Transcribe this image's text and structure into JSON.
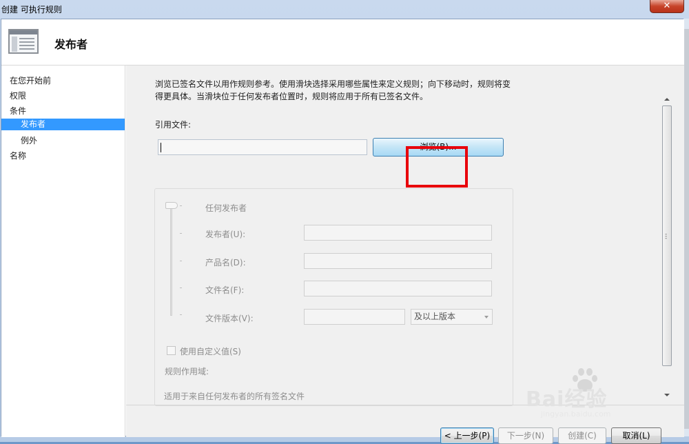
{
  "window": {
    "title": "创建 可执行规则",
    "close_glyph": "✕"
  },
  "header": {
    "title": "发布者",
    "icon": "wizard-icon"
  },
  "nav": {
    "items": [
      {
        "label": "在您开始前"
      },
      {
        "label": "权限"
      },
      {
        "label": "条件"
      },
      {
        "label": "发布者",
        "selected": true
      },
      {
        "label": "例外"
      },
      {
        "label": "名称"
      }
    ]
  },
  "main": {
    "description": "浏览已签名文件以用作规则参考。使用滑块选择采用哪些属性来定义规则；向下移动时，规则将变得更具体。当滑块位于任何发布者位置时，规则将应用于所有已签名文件。",
    "reference_label": "引用文件:",
    "reference_value": "",
    "browse_label": "浏览(B)...",
    "panel": {
      "any_publisher": "任何发布者",
      "publisher_label": "发布者(U):",
      "publisher_value": "",
      "product_label": "产品名(D):",
      "product_value": "",
      "filename_label": "文件名(F):",
      "filename_value": "",
      "version_label": "文件版本(V):",
      "version_value": "",
      "version_mode": "及以上版本",
      "custom_values_label": "使用自定义值(S)",
      "scope_label": "规则作用域:",
      "scope_text": "适用于来自任何发布者的所有签名文件"
    }
  },
  "footer": {
    "prev": "< 上一步(P)",
    "next": "下一步(N)",
    "create": "创建(C)",
    "cancel": "取消(L)"
  },
  "watermark": {
    "text": "Bai经验",
    "url": "jingyan.baidu.com"
  },
  "colors": {
    "selection": "#3399ff",
    "highlight_box": "#e8000b"
  }
}
